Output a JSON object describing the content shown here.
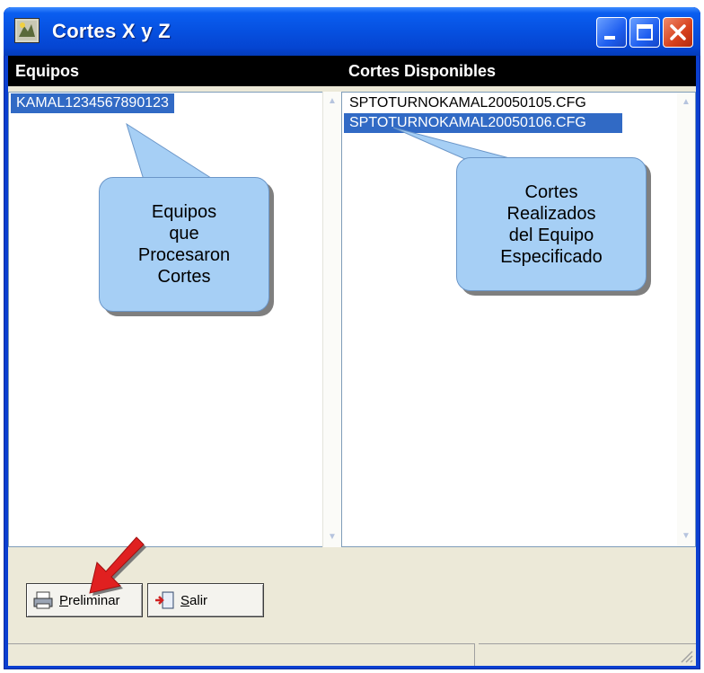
{
  "window": {
    "title": "Cortes X y Z"
  },
  "columns": {
    "equipos": "Equipos",
    "cortes": "Cortes Disponibles"
  },
  "equipos_list": [
    "KAMAL1234567890123"
  ],
  "cortes_list": [
    "SPTOTURNOKAMAL20050105.CFG",
    "SPTOTURNOKAMAL20050106.CFG"
  ],
  "buttons": {
    "preliminar": {
      "mnemonic": "P",
      "rest": "reliminar"
    },
    "salir": {
      "mnemonic": "S",
      "rest": "alir"
    }
  },
  "callouts": {
    "equipos": [
      "Equipos",
      "que",
      "Procesaron",
      "Cortes"
    ],
    "cortes": [
      "Cortes",
      "Realizados",
      "del Equipo",
      "Especificado"
    ]
  },
  "icons": [
    "app-icon",
    "minimize-icon",
    "maximize-icon",
    "close-icon",
    "printer-icon",
    "exit-door-icon",
    "red-arrow-icon"
  ],
  "colors": {
    "title_bar": "#0650e0",
    "selection": "#316ac5",
    "callout": "#a6cff5",
    "arrow": "#e02020"
  }
}
